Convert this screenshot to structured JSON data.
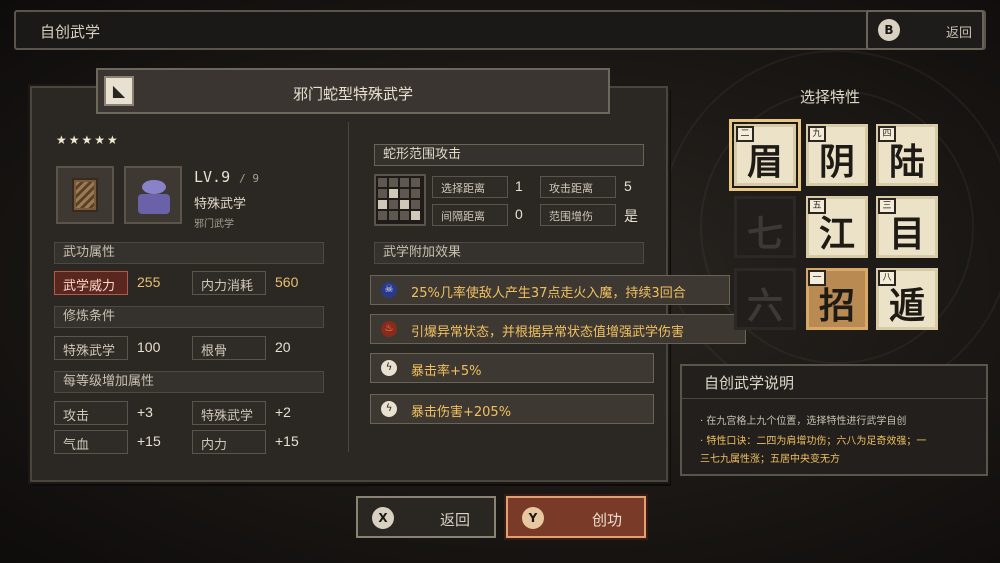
{
  "header": {
    "title": "自创武学",
    "back_badge": "B",
    "back_label": "返回"
  },
  "skill": {
    "name": "邪门蛇型特殊武学",
    "stars": "★★★★★",
    "level": "LV.9",
    "level_max": "/ 9",
    "type": "特殊武学",
    "subtype": "邪门武学"
  },
  "martial_attrs": {
    "header": "武功属性",
    "items": [
      {
        "label": "武学威力",
        "value": "255"
      },
      {
        "label": "内力消耗",
        "value": "560"
      }
    ]
  },
  "train_cond": {
    "header": "修炼条件",
    "items": [
      {
        "label": "特殊武学",
        "value": "100"
      },
      {
        "label": "根骨",
        "value": "20"
      }
    ]
  },
  "per_level": {
    "header": "每等级增加属性",
    "items": [
      {
        "label": "攻击",
        "value": "+3"
      },
      {
        "label": "特殊武学",
        "value": "+2"
      },
      {
        "label": "气血",
        "value": "+15"
      },
      {
        "label": "内力",
        "value": "+15"
      }
    ]
  },
  "attack": {
    "title": "蛇形范围攻击",
    "stats": [
      {
        "label": "选择距离",
        "value": "1"
      },
      {
        "label": "攻击距离",
        "value": "5"
      },
      {
        "label": "间隔距离",
        "value": "0"
      },
      {
        "label": "范围增伤",
        "value": "是"
      }
    ]
  },
  "extra": {
    "header": "武学附加效果",
    "effects": [
      {
        "icon": "skull-icon",
        "text": "25%几率使敌人产生37点走火入魔，持续3回合"
      },
      {
        "icon": "fire-icon",
        "text": "引爆异常状态，并根据异常状态值增强武学伤害"
      },
      {
        "icon": "lightning-icon",
        "text": "暴击率+5%"
      },
      {
        "icon": "lightning-icon",
        "text": "暴击伤害+205%"
      }
    ]
  },
  "traits": {
    "title": "选择特性",
    "tiles": [
      {
        "char": "眉",
        "num": "二",
        "state": "active"
      },
      {
        "char": "阴",
        "num": "九",
        "state": "active"
      },
      {
        "char": "陆",
        "num": "四",
        "state": "active"
      },
      {
        "char": "七",
        "num": "",
        "state": "dim"
      },
      {
        "char": "江",
        "num": "五",
        "state": "active"
      },
      {
        "char": "目",
        "num": "三",
        "state": "active"
      },
      {
        "char": "六",
        "num": "",
        "state": "dim"
      },
      {
        "char": "招",
        "num": "一",
        "state": "used"
      },
      {
        "char": "遁",
        "num": "八",
        "state": "active"
      }
    ]
  },
  "description": {
    "title": "自创武学说明",
    "line1": "· 在九宫格上九个位置，选择特性进行武学自创",
    "line2": "· 特性口诀：二四为肩增功伤；六八为足奇效强；一",
    "line3": "三七九属性涨；五居中央变无方"
  },
  "buttons": {
    "back_badge": "X",
    "back_label": "返回",
    "create_badge": "Y",
    "create_label": "创功"
  },
  "colors": {
    "accent": "#f0c060",
    "highlight_red": "#5a2620",
    "tile": "#ece2c8"
  }
}
